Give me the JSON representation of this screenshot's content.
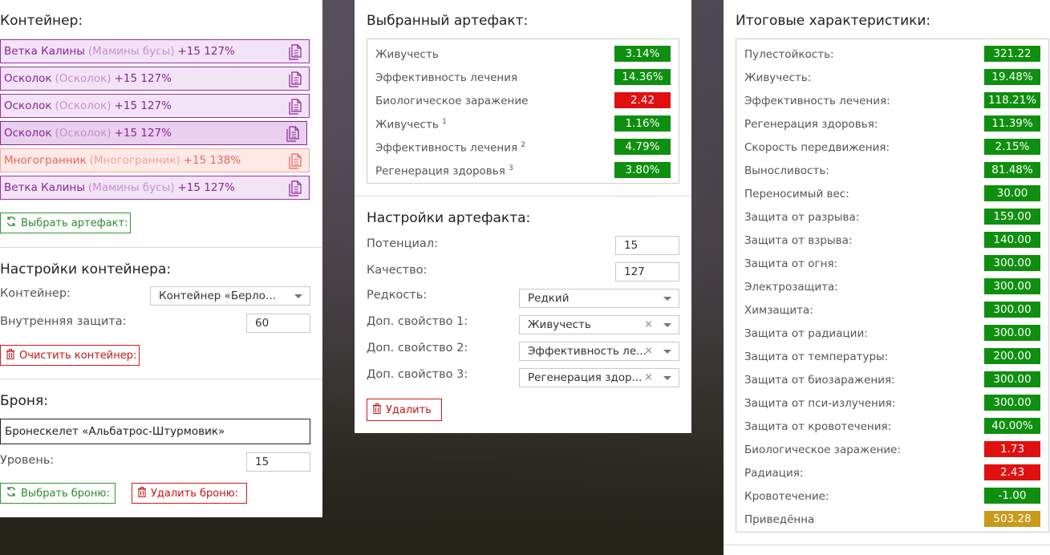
{
  "container": {
    "title": "Контейнер:",
    "slots": [
      {
        "name": "Ветка Калины",
        "sub": "(Мамины бусы)",
        "level": "+15 127%"
      },
      {
        "name": "Осколок",
        "sub": "(Осколок)",
        "level": "+15 127%"
      },
      {
        "name": "Осколок",
        "sub": "(Осколок)",
        "level": "+15 127%"
      },
      {
        "name": "Осколок",
        "sub": "(Осколок)",
        "level": "+15 127%"
      },
      {
        "name": "Многогранник",
        "sub": "(Многогранник)",
        "level": "+15 138%"
      },
      {
        "name": "Ветка Калины",
        "sub": "(Мамины бусы)",
        "level": "+15 127%"
      }
    ],
    "choose_artifact_label": "Выбрать артефакт:"
  },
  "container_settings": {
    "title": "Настройки контейнера:",
    "container_label": "Контейнер:",
    "container_value": "Контейнер «Берлога...",
    "inner_protection_label": "Внутренняя защита:",
    "inner_protection_value": "60",
    "clear_label": "Очистить контейнер:"
  },
  "armor": {
    "title": "Броня:",
    "name": "Бронескелет «Альбатрос-Штурмовик»",
    "level_label": "Уровень:",
    "level_value": "15",
    "choose_label": "Выбрать броню:",
    "delete_label": "Удалить броню:"
  },
  "selected_artifact": {
    "title": "Выбранный артефакт:",
    "stats": [
      {
        "label": "Живучесть",
        "sup": "",
        "value": "3.14%",
        "color": "green"
      },
      {
        "label": "Эффективность лечения",
        "sup": "",
        "value": "14.36%",
        "color": "green"
      },
      {
        "label": "Биологическое заражение",
        "sup": "",
        "value": "2.42",
        "color": "red"
      },
      {
        "label": "Живучесть",
        "sup": "1",
        "value": "1.16%",
        "color": "green"
      },
      {
        "label": "Эффективность лечения",
        "sup": "2",
        "value": "4.79%",
        "color": "green"
      },
      {
        "label": "Регенерация здоровья",
        "sup": "3",
        "value": "3.80%",
        "color": "green"
      }
    ]
  },
  "artifact_settings": {
    "title": "Настройки артефакта:",
    "potential_label": "Потенциал:",
    "potential_value": "15",
    "quality_label": "Качество:",
    "quality_value": "127",
    "rarity_label": "Редкость:",
    "rarity_value": "Редкий",
    "extra1_label": "Доп. свойство 1:",
    "extra1_value": "Живучесть",
    "extra2_label": "Доп. свойство 2:",
    "extra2_value": "Эффективность ле...",
    "extra3_label": "Доп. свойство 3:",
    "extra3_value": "Регенерация здор...",
    "clear_symbol": "×",
    "delete_label": "Удалить"
  },
  "totals": {
    "title": "Итоговые характеристики:",
    "stats": [
      {
        "label": "Пулестойкость:",
        "value": "321.22",
        "color": "green"
      },
      {
        "label": "Живучесть:",
        "value": "19.48%",
        "color": "green"
      },
      {
        "label": "Эффективность лечения:",
        "value": "118.21%",
        "color": "green"
      },
      {
        "label": "Регенерация здоровья:",
        "value": "11.39%",
        "color": "green"
      },
      {
        "label": "Скорость передвижения:",
        "value": "2.15%",
        "color": "green"
      },
      {
        "label": "Выносливость:",
        "value": "81.48%",
        "color": "green"
      },
      {
        "label": "Переносимый вес:",
        "value": "30.00",
        "color": "green"
      },
      {
        "label": "Защита от разрыва:",
        "value": "159.00",
        "color": "green"
      },
      {
        "label": "Защита от взрыва:",
        "value": "140.00",
        "color": "green"
      },
      {
        "label": "Защита от огня:",
        "value": "300.00",
        "color": "green"
      },
      {
        "label": "Электрозащита:",
        "value": "300.00",
        "color": "green"
      },
      {
        "label": "Химзащита:",
        "value": "300.00",
        "color": "green"
      },
      {
        "label": "Защита от радиации:",
        "value": "300.00",
        "color": "green"
      },
      {
        "label": "Защита от температуры:",
        "value": "200.00",
        "color": "green"
      },
      {
        "label": "Защита от биозаражения:",
        "value": "300.00",
        "color": "green"
      },
      {
        "label": "Защита от пси-излучения:",
        "value": "300.00",
        "color": "green"
      },
      {
        "label": "Защита от кровотечения:",
        "value": "40.00%",
        "color": "green"
      },
      {
        "label": "Биологическое заражение:",
        "value": "1.73",
        "color": "red"
      },
      {
        "label": "Радиация:",
        "value": "2.43",
        "color": "red"
      },
      {
        "label": "Кровотечение:",
        "value": "-1.00",
        "color": "green"
      },
      {
        "label": "Приведённа",
        "value": "503.28",
        "color": "gold"
      }
    ]
  },
  "colors": {
    "green": "#0f8f0f",
    "red": "#e01010",
    "gold": "#c79a1a",
    "purple": "#8a2598",
    "orange": "#e8685a"
  }
}
